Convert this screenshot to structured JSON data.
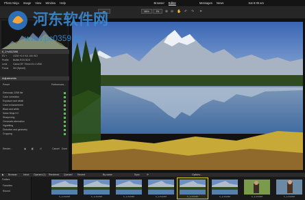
{
  "menubar": {
    "app": "Photo Ninja",
    "items": [
      "Image",
      "View",
      "Window",
      "Help"
    ],
    "modes": [
      "Browser",
      "Editor"
    ],
    "right_items": [
      "Messages",
      "News"
    ],
    "clock": "Sat 8:39 am"
  },
  "toolbar": {
    "zoom": "58%",
    "zoom_mode": "Fit"
  },
  "sidebar": {
    "file_panel_title": "6_1+c612396",
    "info_rows": [
      {
        "label": "EV +",
        "value": "1/200   +0.0   f/11   100 ISO"
      },
      {
        "label": "Profile",
        "value": "Builtin EOS 5DS"
      },
      {
        "label": "Lens",
        "value": "Canon EF 70mm f/1.4 USM"
      },
      {
        "label": "Focus",
        "value": "Zel (Speed)"
      }
    ],
    "adjustments_title": "Adjustments",
    "preset_label": "Preset",
    "preset_value": "Preferences...",
    "adjustments": [
      "Demosaic CRW file",
      "Color correction",
      "Exposure and detail",
      "Color enhancement",
      "Black and white",
      "Noise Ninja 3.0",
      "Sharpening",
      "Chromatic aberration",
      "Vignetting",
      "Distortion and geometry",
      "Cropping"
    ],
    "render_label": "Render...",
    "cancel_label": "Cancel",
    "done_label": "Done"
  },
  "filmstrip": {
    "tabs": [
      "Browser",
      "Inbox",
      "Opened (1)",
      "Rendered",
      "Queued",
      "Recent"
    ],
    "sort_label": "By name",
    "sync_label": "Sync",
    "options_label": "Options...",
    "thumb_captions": [
      "6_1+6120M",
      "6_1+6120M",
      "6_1+6120M",
      "6_1+6120M",
      "6_1+6120M",
      "6_1+6120M",
      "6_1+6120M",
      "6_1+6120M"
    ]
  },
  "folders": {
    "title": "Folders",
    "items": [
      "Favorites",
      "Recent"
    ]
  },
  "watermark": {
    "line1": "河东软件网",
    "line2": "www.pc0359.cn"
  }
}
